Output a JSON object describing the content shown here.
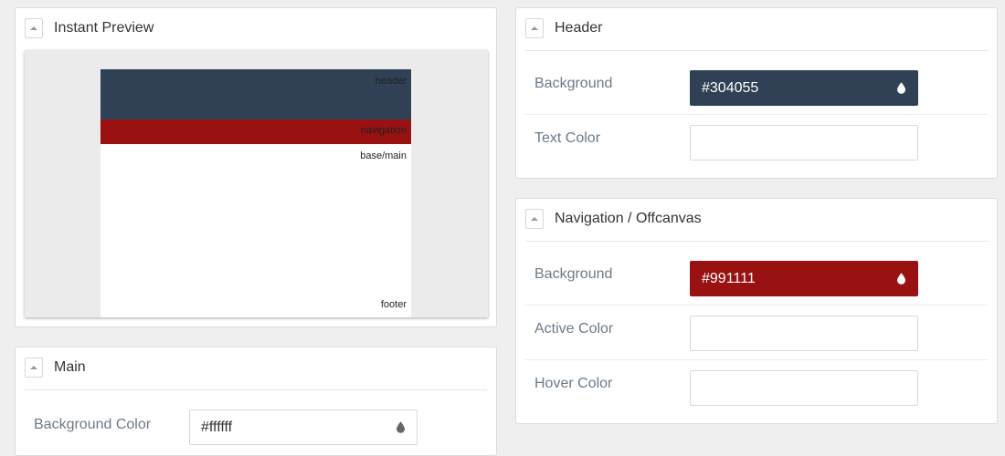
{
  "preview_panel": {
    "title": "Instant Preview",
    "header_label": "header",
    "navigation_label": "navigation",
    "main_label": "base/main",
    "footer_label": "footer"
  },
  "main_panel": {
    "title": "Main",
    "rows": [
      {
        "label": "Background Color",
        "value": "#ffffff"
      }
    ]
  },
  "header_panel": {
    "title": "Header",
    "rows": [
      {
        "label": "Background",
        "value": "#304055"
      },
      {
        "label": "Text Color",
        "value": ""
      }
    ]
  },
  "nav_panel": {
    "title": "Navigation / Offcanvas",
    "rows": [
      {
        "label": "Background",
        "value": "#991111"
      },
      {
        "label": "Active Color",
        "value": ""
      },
      {
        "label": "Hover Color",
        "value": ""
      }
    ]
  },
  "colors": {
    "header_bg": "#304055",
    "nav_bg": "#991111",
    "main_bg": "#ffffff",
    "preview_canvas": "#ebebeb",
    "label_text": "#6b7a88"
  },
  "icons": {
    "collapse": "caret-up-icon",
    "color_picker": "droplet-icon"
  }
}
